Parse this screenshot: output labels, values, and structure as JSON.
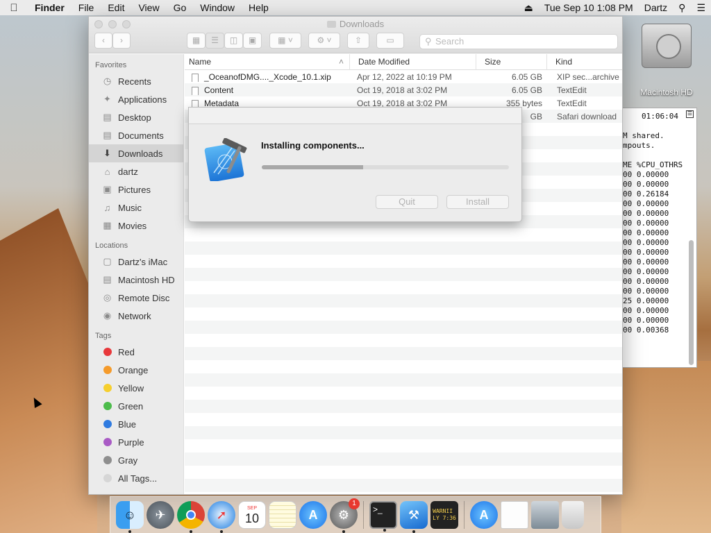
{
  "menubar": {
    "app_name": "Finder",
    "items": [
      "File",
      "Edit",
      "View",
      "Go",
      "Window",
      "Help"
    ],
    "datetime": "Tue Sep 10  1:08 PM",
    "user": "Dartz"
  },
  "desktop": {
    "hd_label": "Macintosh HD"
  },
  "terminal": {
    "time": "01:06:04",
    "lines": [
      "M shared.",
      "mpouts.",
      "",
      "ME %CPU_OTHRS",
      "00 0.00000",
      "00 0.00000",
      "00 0.26184",
      "00 0.00000",
      "00 0.00000",
      "00 0.00000",
      "00 0.00000",
      "00 0.00000",
      "00 0.00000",
      "00 0.00000",
      "00 0.00000",
      "00 0.00000",
      "00 0.00000",
      "25 0.00000",
      "00 0.00000",
      "00 0.00000",
      "00 0.00368"
    ]
  },
  "finder": {
    "title": "Downloads",
    "search_placeholder": "Search",
    "sidebar": {
      "favorites_header": "Favorites",
      "favorites": [
        {
          "label": "Recents",
          "icon": "recents-icon"
        },
        {
          "label": "Applications",
          "icon": "applications-icon"
        },
        {
          "label": "Desktop",
          "icon": "desktop-icon"
        },
        {
          "label": "Documents",
          "icon": "documents-icon"
        },
        {
          "label": "Downloads",
          "icon": "downloads-icon",
          "selected": true
        },
        {
          "label": "dartz",
          "icon": "home-icon"
        },
        {
          "label": "Pictures",
          "icon": "pictures-icon"
        },
        {
          "label": "Music",
          "icon": "music-icon"
        },
        {
          "label": "Movies",
          "icon": "movies-icon"
        }
      ],
      "locations_header": "Locations",
      "locations": [
        {
          "label": "Dartz's iMac",
          "icon": "imac-icon"
        },
        {
          "label": "Macintosh HD",
          "icon": "drive-icon"
        },
        {
          "label": "Remote Disc",
          "icon": "disc-icon"
        },
        {
          "label": "Network",
          "icon": "globe-icon"
        }
      ],
      "tags_header": "Tags",
      "tags": [
        {
          "label": "Red",
          "color": "#e8383b"
        },
        {
          "label": "Orange",
          "color": "#f59b2b"
        },
        {
          "label": "Yellow",
          "color": "#f6cf2e"
        },
        {
          "label": "Green",
          "color": "#4cbc4b"
        },
        {
          "label": "Blue",
          "color": "#2f7be0"
        },
        {
          "label": "Purple",
          "color": "#a95bc5"
        },
        {
          "label": "Gray",
          "color": "#8e8e8e"
        },
        {
          "label": "All Tags...",
          "color": "#d6d6d6"
        }
      ]
    },
    "columns": {
      "name": "Name",
      "modified": "Date Modified",
      "size": "Size",
      "kind": "Kind"
    },
    "files": [
      {
        "name": "_OceanofDMG...._Xcode_10.1.xip",
        "modified": "Apr 12, 2022 at 10:19 PM",
        "size": "6.05 GB",
        "kind": "XIP sec...archive"
      },
      {
        "name": "Content",
        "modified": "Oct 19, 2018 at 3:02 PM",
        "size": "6.05 GB",
        "kind": "TextEdit"
      },
      {
        "name": "Metadata",
        "modified": "Oct 19, 2018 at 3:02 PM",
        "size": "355 bytes",
        "kind": "TextEdit"
      },
      {
        "name": "",
        "modified": "",
        "size": "GB",
        "kind": "Safari download"
      }
    ]
  },
  "dialog": {
    "title": "Installing components...",
    "progress": 0.41,
    "quit_label": "Quit",
    "install_label": "Install"
  },
  "dock": {
    "calendar_month": "SEP",
    "calendar_day": "10",
    "console_text": "WARNII\nLY 7:36",
    "settings_badge": "1"
  }
}
